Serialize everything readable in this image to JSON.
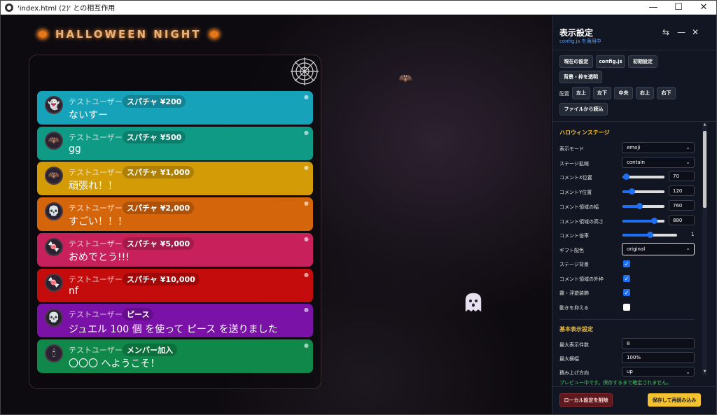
{
  "window": {
    "title": "'index.html (2)' との相互作用",
    "minimize": "—",
    "maximize": "☐",
    "close": "✕"
  },
  "stage": {
    "header_title": "HALLOWEEN NIGHT",
    "cards": [
      {
        "user": "テストユーザー",
        "badge": "スパチャ ¥200",
        "msg": "ないすー",
        "color": "#16a2b8",
        "avatar": "👻"
      },
      {
        "user": "テストユーザー",
        "badge": "スパチャ ¥500",
        "msg": "gg",
        "color": "#0f9a86",
        "avatar": "🦇"
      },
      {
        "user": "テストユーザー",
        "badge": "スパチャ ¥1,000",
        "msg": "頑張れ！！",
        "color": "#d39b06",
        "avatar": "🦇"
      },
      {
        "user": "テストユーザー",
        "badge": "スパチャ ¥2,000",
        "msg": "すごい！！！",
        "color": "#d4650a",
        "avatar": "💀"
      },
      {
        "user": "テストユーザー",
        "badge": "スパチャ ¥5,000",
        "msg": "おめでとう!!!",
        "color": "#c8205a",
        "avatar": "🍬"
      },
      {
        "user": "テストユーザー",
        "badge": "スパチャ ¥10,000",
        "msg": "nf",
        "color": "#c40c0c",
        "avatar": "🍬"
      },
      {
        "user": "テストユーザー",
        "badge": "ピース",
        "msg": "ジュエル 100 個 を使って ピース を送りました",
        "color": "#7a12a8",
        "avatar": "💀"
      },
      {
        "user": "テストユーザー",
        "badge": "メンバー加入",
        "msg": "〇〇〇 へようこそ！",
        "color": "#10884a",
        "avatar": "🕯"
      }
    ]
  },
  "panel": {
    "title": "表示設定",
    "subtitle": "config.js を適用中",
    "icons": {
      "swap": "swap-icon",
      "minimize": "minimize-icon",
      "close": "close-icon"
    },
    "buttons": {
      "current": "現在の設定",
      "configjs": "config.js",
      "initial": "初期設定",
      "transparent": "背景・枠を透明",
      "pos_label": "配置",
      "pos": [
        "左上",
        "左下",
        "中央",
        "右上",
        "右下"
      ],
      "load_file": "ファイルから読込"
    },
    "section1": "ハロウィンステージ",
    "rows": {
      "display_mode": {
        "label": "表示モード",
        "value": "emoji"
      },
      "stage_scale": {
        "label": "ステージ拡縮",
        "value": "contain"
      },
      "comment_x": {
        "label": "コメントX位置",
        "value": "70",
        "fraction": 0.08
      },
      "comment_y": {
        "label": "コメントY位置",
        "value": "120",
        "fraction": 0.22
      },
      "comment_w": {
        "label": "コメント領域の幅",
        "value": "760",
        "fraction": 0.4
      },
      "comment_h": {
        "label": "コメント領域の高さ",
        "value": "880",
        "fraction": 0.75
      },
      "comment_scale": {
        "label": "コメント倍率",
        "value": "1",
        "fraction": 0.5
      },
      "gift_color": {
        "label": "ギフト配色",
        "value": "original"
      },
      "stage_bg": {
        "label": "ステージ背景",
        "checked": true
      },
      "comment_frame": {
        "label": "コメント領域の外枠",
        "checked": true
      },
      "fog": {
        "label": "霧・浮遊装飾",
        "checked": true
      },
      "reduce_motion": {
        "label": "動きを抑える",
        "checked": false
      }
    },
    "section2": "基本表示設定",
    "rows2": {
      "max_count": {
        "label": "最大表示件数",
        "value": "8"
      },
      "max_width": {
        "label": "最大横幅",
        "value": "100%"
      },
      "stack_dir": {
        "label": "積み上げ方向",
        "value": "up"
      }
    },
    "note": "プレビュー中です。保存するまで確定されません。",
    "clear_btn": "ローカル設定を削除",
    "save_btn": "保存して再読み込み"
  }
}
